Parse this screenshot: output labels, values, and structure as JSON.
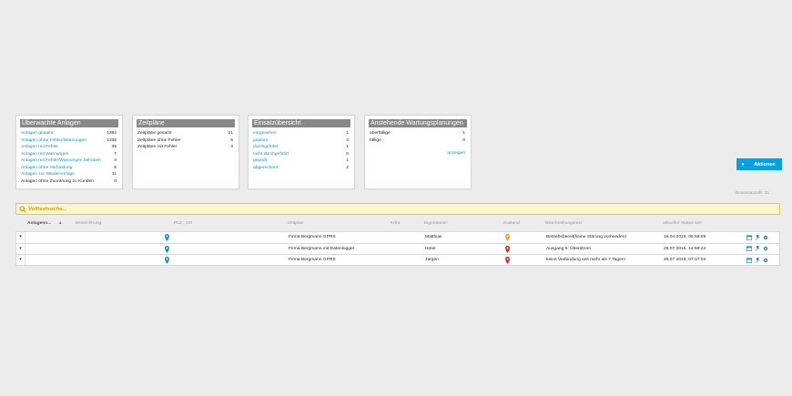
{
  "cards": [
    {
      "title": "Überwachte Anlagen",
      "rows": [
        {
          "label": "Anlagen gesamt",
          "value": "1392",
          "link": true
        },
        {
          "label": "Anlagen ohne Fehler/Warnungen",
          "value": "1338",
          "link": true
        },
        {
          "label": "Anlagen mit Fehler",
          "value": "35",
          "link": true
        },
        {
          "label": "Anlagen mit Warnungen",
          "value": "7",
          "link": true
        },
        {
          "label": "Anlagen mit Fehler/Warnungen behoben",
          "value": "4",
          "link": true
        },
        {
          "label": "Anlagen ohne Verbindung",
          "value": "6",
          "link": true
        },
        {
          "label": "Anlagen zur Wiedervorlage",
          "value": "11",
          "link": true
        },
        {
          "label": "Anlagen ohne Zuordnung zu Kunden",
          "value": "0",
          "link": false
        }
      ]
    },
    {
      "title": "Zeitpläne",
      "rows": [
        {
          "label": "Zeitpläne gesamt",
          "value": "21",
          "link": false
        },
        {
          "label": "Zeitpläne ohne Fehler",
          "value": "5",
          "link": false
        },
        {
          "label": "Zeitpläne mit Fehler",
          "value": "4",
          "link": false
        }
      ]
    },
    {
      "title": "Einsatzübersicht",
      "rows": [
        {
          "label": "vorgesehen",
          "value": "1",
          "link": true
        },
        {
          "label": "geplant",
          "value": "4",
          "link": true
        },
        {
          "label": "durchgeführt",
          "value": "1",
          "link": true
        },
        {
          "label": "nicht durchgeführt",
          "value": "0",
          "link": true
        },
        {
          "label": "geprüft",
          "value": "1",
          "link": true
        },
        {
          "label": "abgerechnet",
          "value": "2",
          "link": true
        }
      ]
    },
    {
      "title": "Anstehende Wartungsplanungen",
      "rows": [
        {
          "label": "überfällige",
          "value": "1",
          "link": false
        },
        {
          "label": "fällige",
          "value": "0",
          "link": false
        }
      ],
      "link": "anzeigen"
    }
  ],
  "actions": {
    "label": "Aktionen",
    "caret": "▾"
  },
  "gesamtanzahl": "Gesamtanzahl: 31",
  "search": {
    "placeholder": "Volltextsuche..."
  },
  "columns": {
    "anlagenr": "Anlagenn...",
    "bezeichnung": "Bezeichnung",
    "plz_ort": "PLZ , Ort",
    "zeitplan": "Zeitplan",
    "kdnr": "Kdnr.",
    "eigentuemer": "Eigentümer",
    "zustand": "Zustand",
    "beschreibung": "Beschreibungstext",
    "status_seit": "aktueller Status seit"
  },
  "rows": [
    {
      "zeitplan": "Firma Bergmann GPRS",
      "eigentuemer": "Matthias",
      "zustand_color": "#f0a21c",
      "beschreibung": "Betriebsbereit(keine Störung vorhanden)",
      "status_seit": "18.04.2015, 05:59:59"
    },
    {
      "zeitplan": "Firma Bergmann mit Datenlogger",
      "eigentuemer": "Hotel",
      "zustand_color": "#d9261c",
      "beschreibung": "Ausgang 5: Überstrom",
      "status_seit": "26.07.2015, 14:59:24"
    },
    {
      "zeitplan": "Firma Bergmann GPRS",
      "eigentuemer": "Jürgen",
      "zustand_color": "#d9261c",
      "beschreibung": "keine Verbindung seit mehr als 7 Tagen!",
      "status_seit": "26.07.2015, 07:37:04"
    }
  ],
  "colors": {
    "accent": "#0b9ee0",
    "link": "#1a8fb8",
    "card_header": "#888888",
    "search_bg": "#fdf6c8"
  }
}
